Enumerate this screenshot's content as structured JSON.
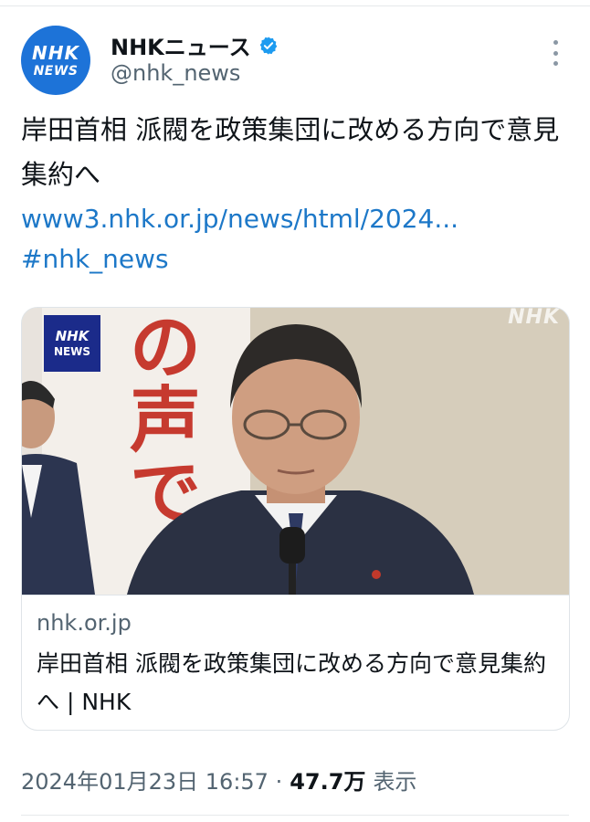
{
  "author": {
    "avatar_line1": "NHK",
    "avatar_line2": "NEWS",
    "display_name": "NHKニュース",
    "handle": "@nhk_news",
    "verified_icon": "verified-badge-icon"
  },
  "tweet": {
    "text": "岸田首相 派閥を政策集団に改める方向で意見集約へ",
    "link": "www3.nhk.or.jp/news/html/2024...",
    "hashtag": "#nhk_news"
  },
  "card": {
    "badge_line1": "NHK",
    "badge_line2": "NEWS",
    "watermark": "NHK",
    "poster_text": "の声で",
    "domain": "nhk.or.jp",
    "title": "岸田首相 派閥を政策集団に改める方向で意見集約へ | NHK"
  },
  "meta": {
    "timestamp": "2024年01月23日 16:57 ·",
    "views_count": "47.7万",
    "views_label": "表示"
  },
  "colors": {
    "link": "#1d78c8",
    "brand_blue": "#1d73d8",
    "secondary_text": "#536471"
  }
}
